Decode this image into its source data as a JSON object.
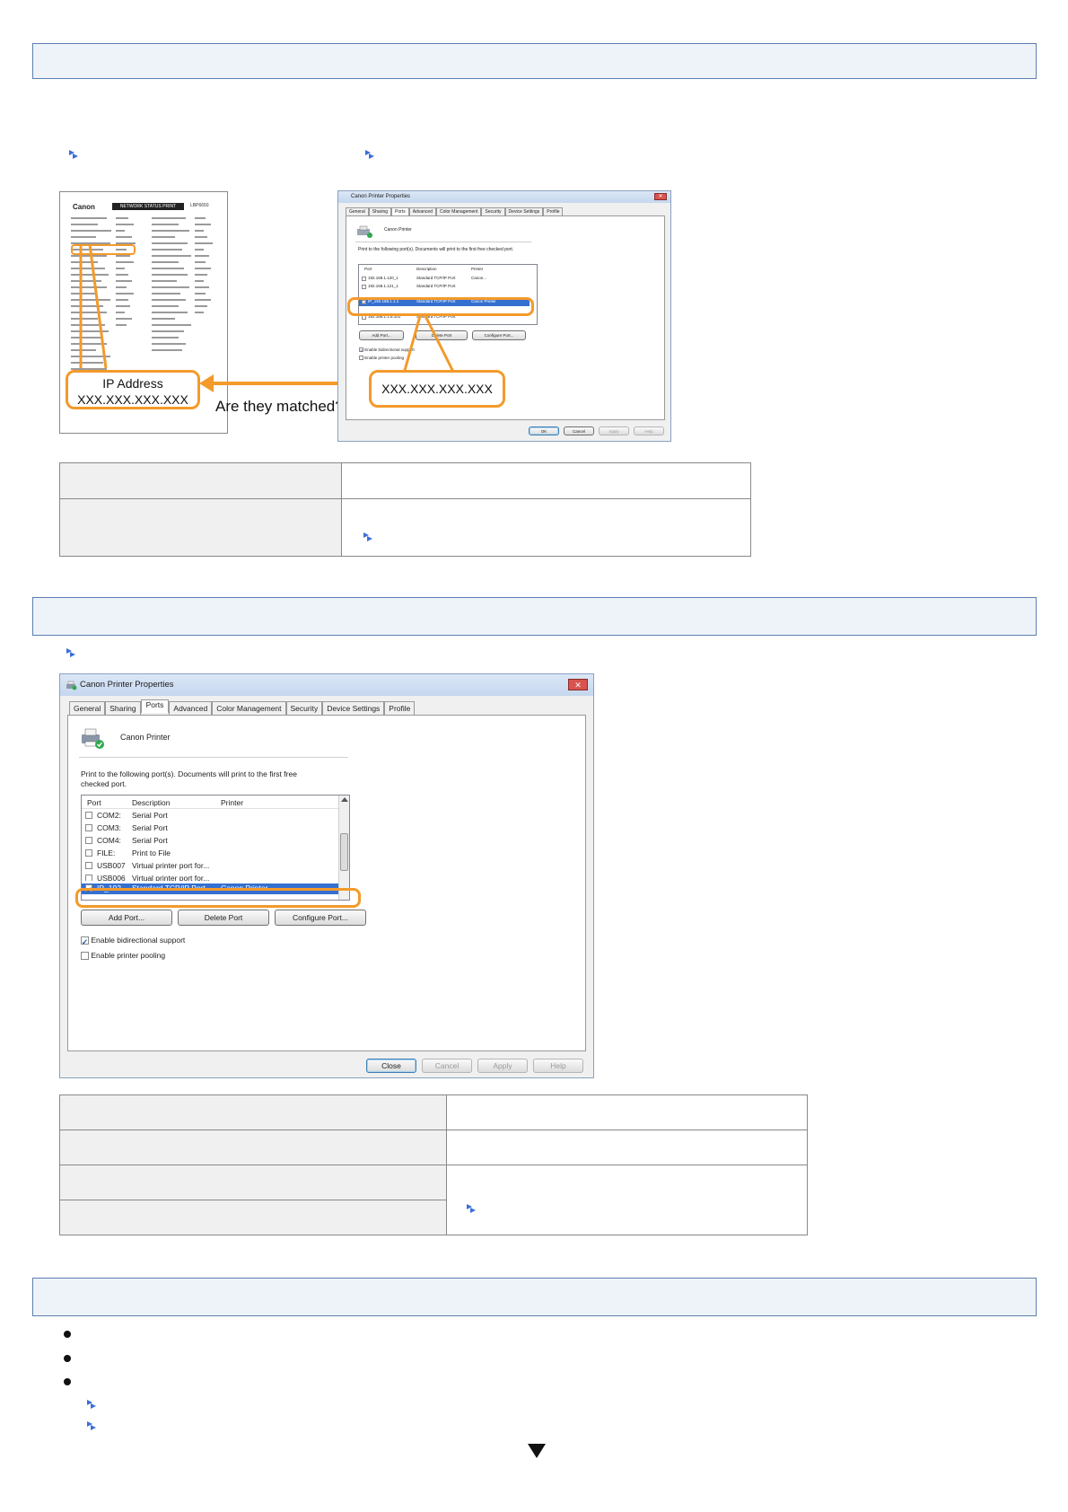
{
  "figure1": {
    "config_page": {
      "brand": "Canon",
      "header": "NETWORK STATUS PRINT",
      "model": "LBP6650"
    },
    "callout_ip_label": "IP Address",
    "callout_ip_value": "XXX.XXX.XXX.XXX",
    "question": "Are they matched?",
    "callout_port_value": "XXX.XXX.XXX.XXX",
    "small_dialog": {
      "title": "Canon Printer Properties",
      "tabs": [
        "General",
        "Sharing",
        "Ports",
        "Advanced",
        "Color Management",
        "Security",
        "Device Settings",
        "Profile"
      ],
      "printer_name": "Canon Printer",
      "instruction": "Print to the following port(s). Documents will print to the first free checked port.",
      "columns": [
        "Port",
        "Description",
        "Printer"
      ],
      "rows": [
        {
          "port": "192.168.1.120_1",
          "desc": "Standard TCP/IP Port",
          "printer": "Canon..."
        },
        {
          "port": "192.168.1.121_1",
          "desc": "Standard TCP/IP Port",
          "printer": ""
        },
        {
          "port": "IP_192.168.1.1.1",
          "desc": "Standard TCP/IP Port",
          "printer": "Canon Printer"
        },
        {
          "port": "192.168.1.1.8.101",
          "desc": "Standard TCP/IP Port",
          "printer": ""
        }
      ],
      "buttons": [
        "Add Port...",
        "Delete Port",
        "Configure Port..."
      ],
      "enable_bidirectional": "Enable bidirectional support",
      "enable_pooling": "Enable printer pooling",
      "footer_buttons": [
        "OK",
        "Cancel",
        "Apply",
        "Help"
      ]
    }
  },
  "figure2": {
    "dialog": {
      "title": "Canon Printer Properties",
      "tabs": [
        "General",
        "Sharing",
        "Ports",
        "Advanced",
        "Color Management",
        "Security",
        "Device Settings",
        "Profile"
      ],
      "printer_name": "Canon Printer",
      "instruction_line1": "Print to the following port(s). Documents will print to the first free",
      "instruction_line2": "checked port.",
      "columns": [
        "Port",
        "Description",
        "Printer"
      ],
      "rows": [
        {
          "port": "COM2:",
          "desc": "Serial Port",
          "printer": ""
        },
        {
          "port": "COM3:",
          "desc": "Serial Port",
          "printer": ""
        },
        {
          "port": "COM4:",
          "desc": "Serial Port",
          "printer": ""
        },
        {
          "port": "FILE:",
          "desc": "Print to File",
          "printer": ""
        },
        {
          "port": "USB007",
          "desc": "Virtual printer port for...",
          "printer": ""
        },
        {
          "port": "USB006",
          "desc": "Virtual printer port for...",
          "printer": ""
        }
      ],
      "selected_row": {
        "port": "IP_192....",
        "desc": "Standard TCP/IP Port",
        "printer": "Canon Printer"
      },
      "buttons": [
        "Add Port...",
        "Delete Port",
        "Configure Port..."
      ],
      "enable_bidirectional": "Enable bidirectional support",
      "enable_pooling": "Enable printer pooling",
      "footer_buttons": [
        "Close",
        "Cancel",
        "Apply",
        "Help"
      ]
    }
  },
  "colors": {
    "accent_orange": "#f39a2b",
    "section_border": "#5a7fb0",
    "selection_blue": "#3470d0"
  },
  "icons": [
    "link-arrow-icon",
    "printer-icon",
    "close-icon",
    "double-arrow-icon",
    "down-triangle-icon"
  ]
}
